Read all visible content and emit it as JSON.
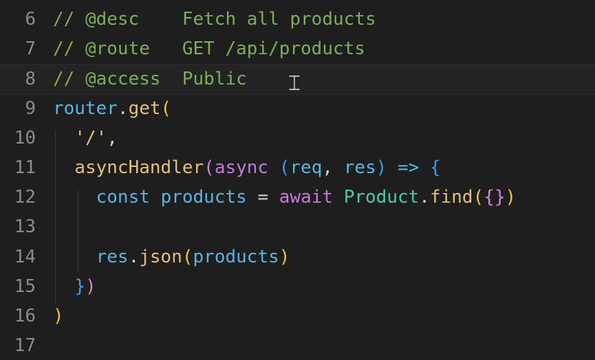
{
  "colors": {
    "background": "#1e1e1e",
    "line_number": "#8c8c8c",
    "comment": "#7fae5a",
    "identifier": "#56b6e8",
    "function": "#e5c07b",
    "string": "#e5c07b",
    "keyword": "#c678dd",
    "operator": "#56b6e8",
    "class": "#4ec9b0",
    "bracket_level_1": "#f3c33c",
    "bracket_level_2": "#d982d8",
    "bracket_level_3": "#3e9bf2",
    "plain": "#d4d4d4"
  },
  "cursor_icon": "text-cursor-ibeam-icon",
  "lines": [
    {
      "number": "6",
      "tokens": [
        {
          "text": "// @desc    Fetch all products",
          "kind": "comment"
        }
      ]
    },
    {
      "number": "7",
      "tokens": [
        {
          "text": "// @route   GET /api/products",
          "kind": "comment"
        }
      ]
    },
    {
      "number": "8",
      "current": true,
      "tokens": [
        {
          "text": "// @access  Public",
          "kind": "comment"
        }
      ]
    },
    {
      "number": "9",
      "tokens": [
        {
          "text": "router",
          "kind": "identifier"
        },
        {
          "text": ".",
          "kind": "plain"
        },
        {
          "text": "get",
          "kind": "function"
        },
        {
          "text": "(",
          "kind": "bracket_level_1"
        }
      ]
    },
    {
      "number": "10",
      "tokens": [
        {
          "text": "  ",
          "kind": "plain"
        },
        {
          "text": "'/'",
          "kind": "string"
        },
        {
          "text": ",",
          "kind": "plain"
        }
      ]
    },
    {
      "number": "11",
      "tokens": [
        {
          "text": "  ",
          "kind": "plain"
        },
        {
          "text": "asyncHandler",
          "kind": "function"
        },
        {
          "text": "(",
          "kind": "bracket_level_2"
        },
        {
          "text": "async",
          "kind": "keyword"
        },
        {
          "text": " ",
          "kind": "plain"
        },
        {
          "text": "(",
          "kind": "bracket_level_3"
        },
        {
          "text": "req",
          "kind": "identifier"
        },
        {
          "text": ", ",
          "kind": "plain"
        },
        {
          "text": "res",
          "kind": "identifier"
        },
        {
          "text": ")",
          "kind": "bracket_level_3"
        },
        {
          "text": " ",
          "kind": "plain"
        },
        {
          "text": "=>",
          "kind": "operator"
        },
        {
          "text": " ",
          "kind": "plain"
        },
        {
          "text": "{",
          "kind": "bracket_level_3"
        }
      ]
    },
    {
      "number": "12",
      "tokens": [
        {
          "text": "    ",
          "kind": "plain"
        },
        {
          "text": "const",
          "kind": "operator"
        },
        {
          "text": " ",
          "kind": "plain"
        },
        {
          "text": "products",
          "kind": "identifier"
        },
        {
          "text": " = ",
          "kind": "plain"
        },
        {
          "text": "await",
          "kind": "keyword"
        },
        {
          "text": " ",
          "kind": "plain"
        },
        {
          "text": "Product",
          "kind": "class"
        },
        {
          "text": ".",
          "kind": "plain"
        },
        {
          "text": "find",
          "kind": "function"
        },
        {
          "text": "(",
          "kind": "bracket_level_1"
        },
        {
          "text": "{}",
          "kind": "bracket_level_2"
        },
        {
          "text": ")",
          "kind": "bracket_level_1"
        }
      ]
    },
    {
      "number": "13",
      "tokens": []
    },
    {
      "number": "14",
      "tokens": [
        {
          "text": "    ",
          "kind": "plain"
        },
        {
          "text": "res",
          "kind": "identifier"
        },
        {
          "text": ".",
          "kind": "plain"
        },
        {
          "text": "json",
          "kind": "function"
        },
        {
          "text": "(",
          "kind": "bracket_level_1"
        },
        {
          "text": "products",
          "kind": "identifier"
        },
        {
          "text": ")",
          "kind": "bracket_level_1"
        }
      ]
    },
    {
      "number": "15",
      "tokens": [
        {
          "text": "  ",
          "kind": "plain"
        },
        {
          "text": "}",
          "kind": "bracket_level_3"
        },
        {
          "text": ")",
          "kind": "bracket_level_2"
        }
      ]
    },
    {
      "number": "16",
      "tokens": [
        {
          "text": ")",
          "kind": "bracket_level_1"
        }
      ]
    },
    {
      "number": "17",
      "tokens": []
    }
  ]
}
